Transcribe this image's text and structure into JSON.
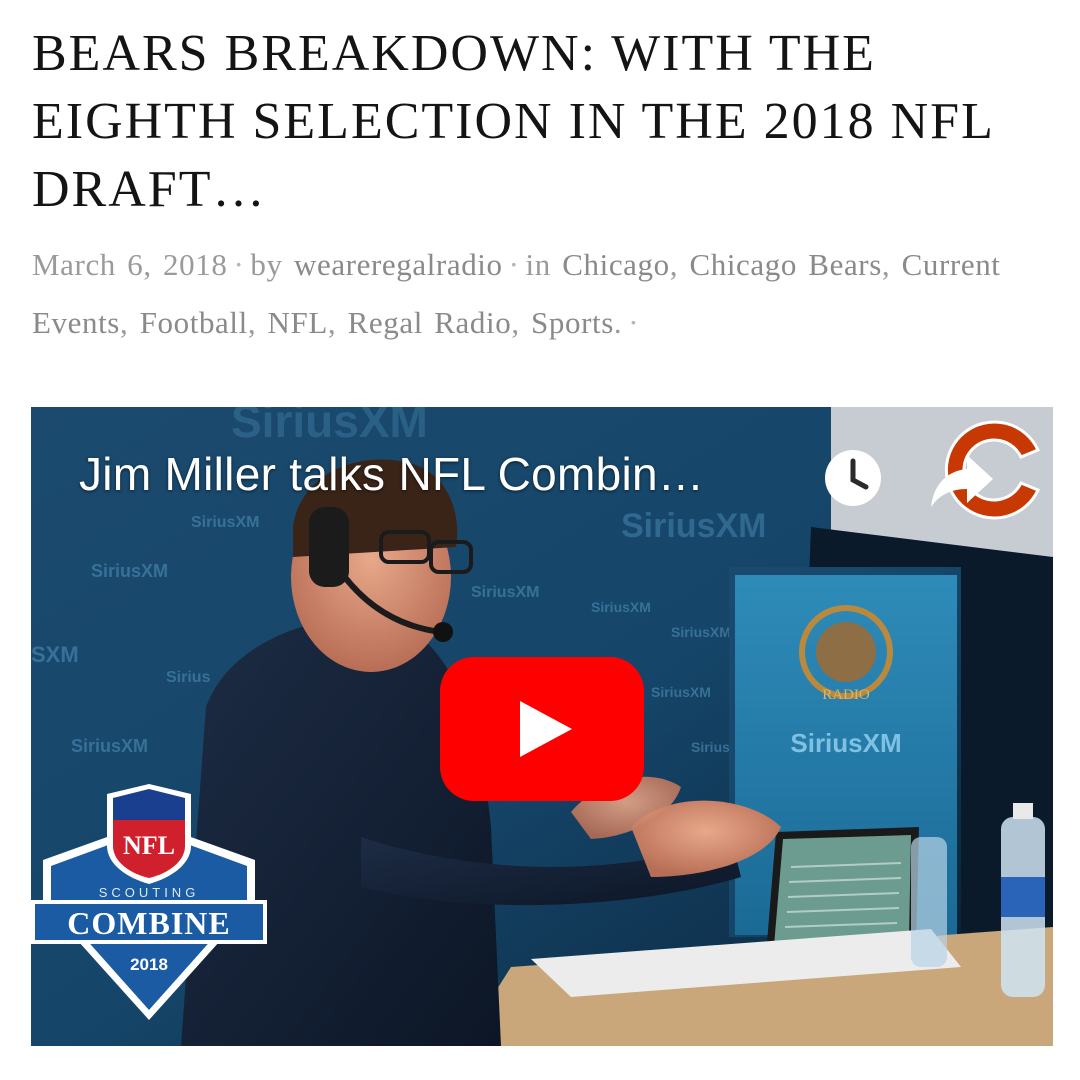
{
  "article": {
    "title": "BEARS BREAKDOWN: WITH THE EIGHTH SELECTION IN THE 2018 NFL DRAFT…"
  },
  "meta": {
    "date": "March 6, 2018",
    "by_label": "by",
    "author": "weareregalradio",
    "in_label": "in",
    "categories": [
      "Chicago",
      "Chicago Bears",
      "Current Events",
      "Football",
      "NFL",
      "Regal Radio",
      "Sports"
    ],
    "separator": "·",
    "trailing_separator": "·"
  },
  "video": {
    "title": "Jim Miller talks NFL Combin…",
    "icons": {
      "watch_later": "clock-icon",
      "share": "share-icon",
      "play": "youtube-play-icon"
    },
    "backdrop_text": "SiriusXM",
    "banner_text": "RADIO",
    "combine_logo": {
      "small_label": "SCOUTING",
      "big_label": "COMBINE",
      "year": "2018",
      "shield_text": "NFL"
    }
  },
  "colors": {
    "title": "#141414",
    "meta": "#9a9a9a",
    "youtube_red": "#ff0000",
    "combine_blue": "#1a5ba3",
    "bears_orange": "#c83803"
  }
}
